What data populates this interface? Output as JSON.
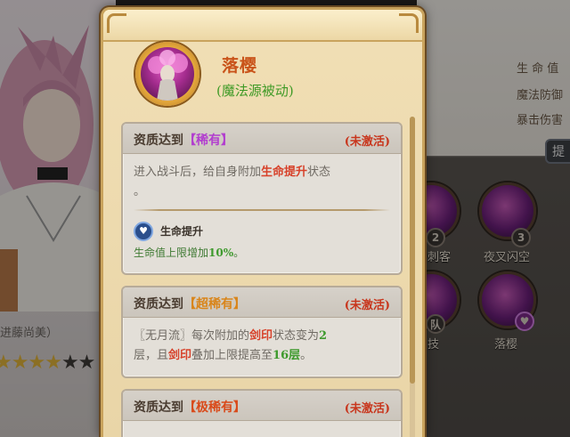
{
  "background": {
    "stats": [
      "生 命 值",
      "魔法防御",
      "暴击伤害"
    ],
    "character_name": "进藤尚美）",
    "stars_filled": 4,
    "stars_total": 6,
    "skills": [
      {
        "label": "刺客",
        "badge": "2"
      },
      {
        "label": "夜叉闪空",
        "badge": "3"
      },
      {
        "label": "技",
        "badge": "队"
      },
      {
        "label": "落樱",
        "badge": "♥"
      }
    ],
    "side_tab_glyph": "提"
  },
  "panel": {
    "title": "落樱",
    "subtitle": "(魔法源被动)",
    "cards": [
      {
        "prefix": "资质达到",
        "rarity": "【稀有】",
        "rarity_color": "#b23ecf",
        "status": "(未激活)",
        "desc_1": "进入战斗后，给自身附加",
        "desc_hl": "生命提升",
        "desc_2": "状态",
        "desc_3": "。",
        "buff_icon": "heart-shield-icon",
        "buff_name": "生命提升",
        "buff_desc_1": "生命值上限增加",
        "buff_desc_num": "10%",
        "buff_desc_2": "。"
      },
      {
        "prefix": "资质达到",
        "rarity": "【超稀有】",
        "rarity_color": "#d9851a",
        "status": "(未激活)",
        "t1": "〖无月流〗每次附加的",
        "t2": "剑印",
        "t3": "状态变为",
        "t4": "2",
        "t5": "层，且",
        "t6": "剑印",
        "t7": "叠加上限提高至",
        "t8": "16层",
        "t9": "。"
      },
      {
        "prefix": "资质达到",
        "rarity": "【极稀有】",
        "rarity_color": "#d94a1a",
        "status": "(未激活)"
      }
    ]
  }
}
